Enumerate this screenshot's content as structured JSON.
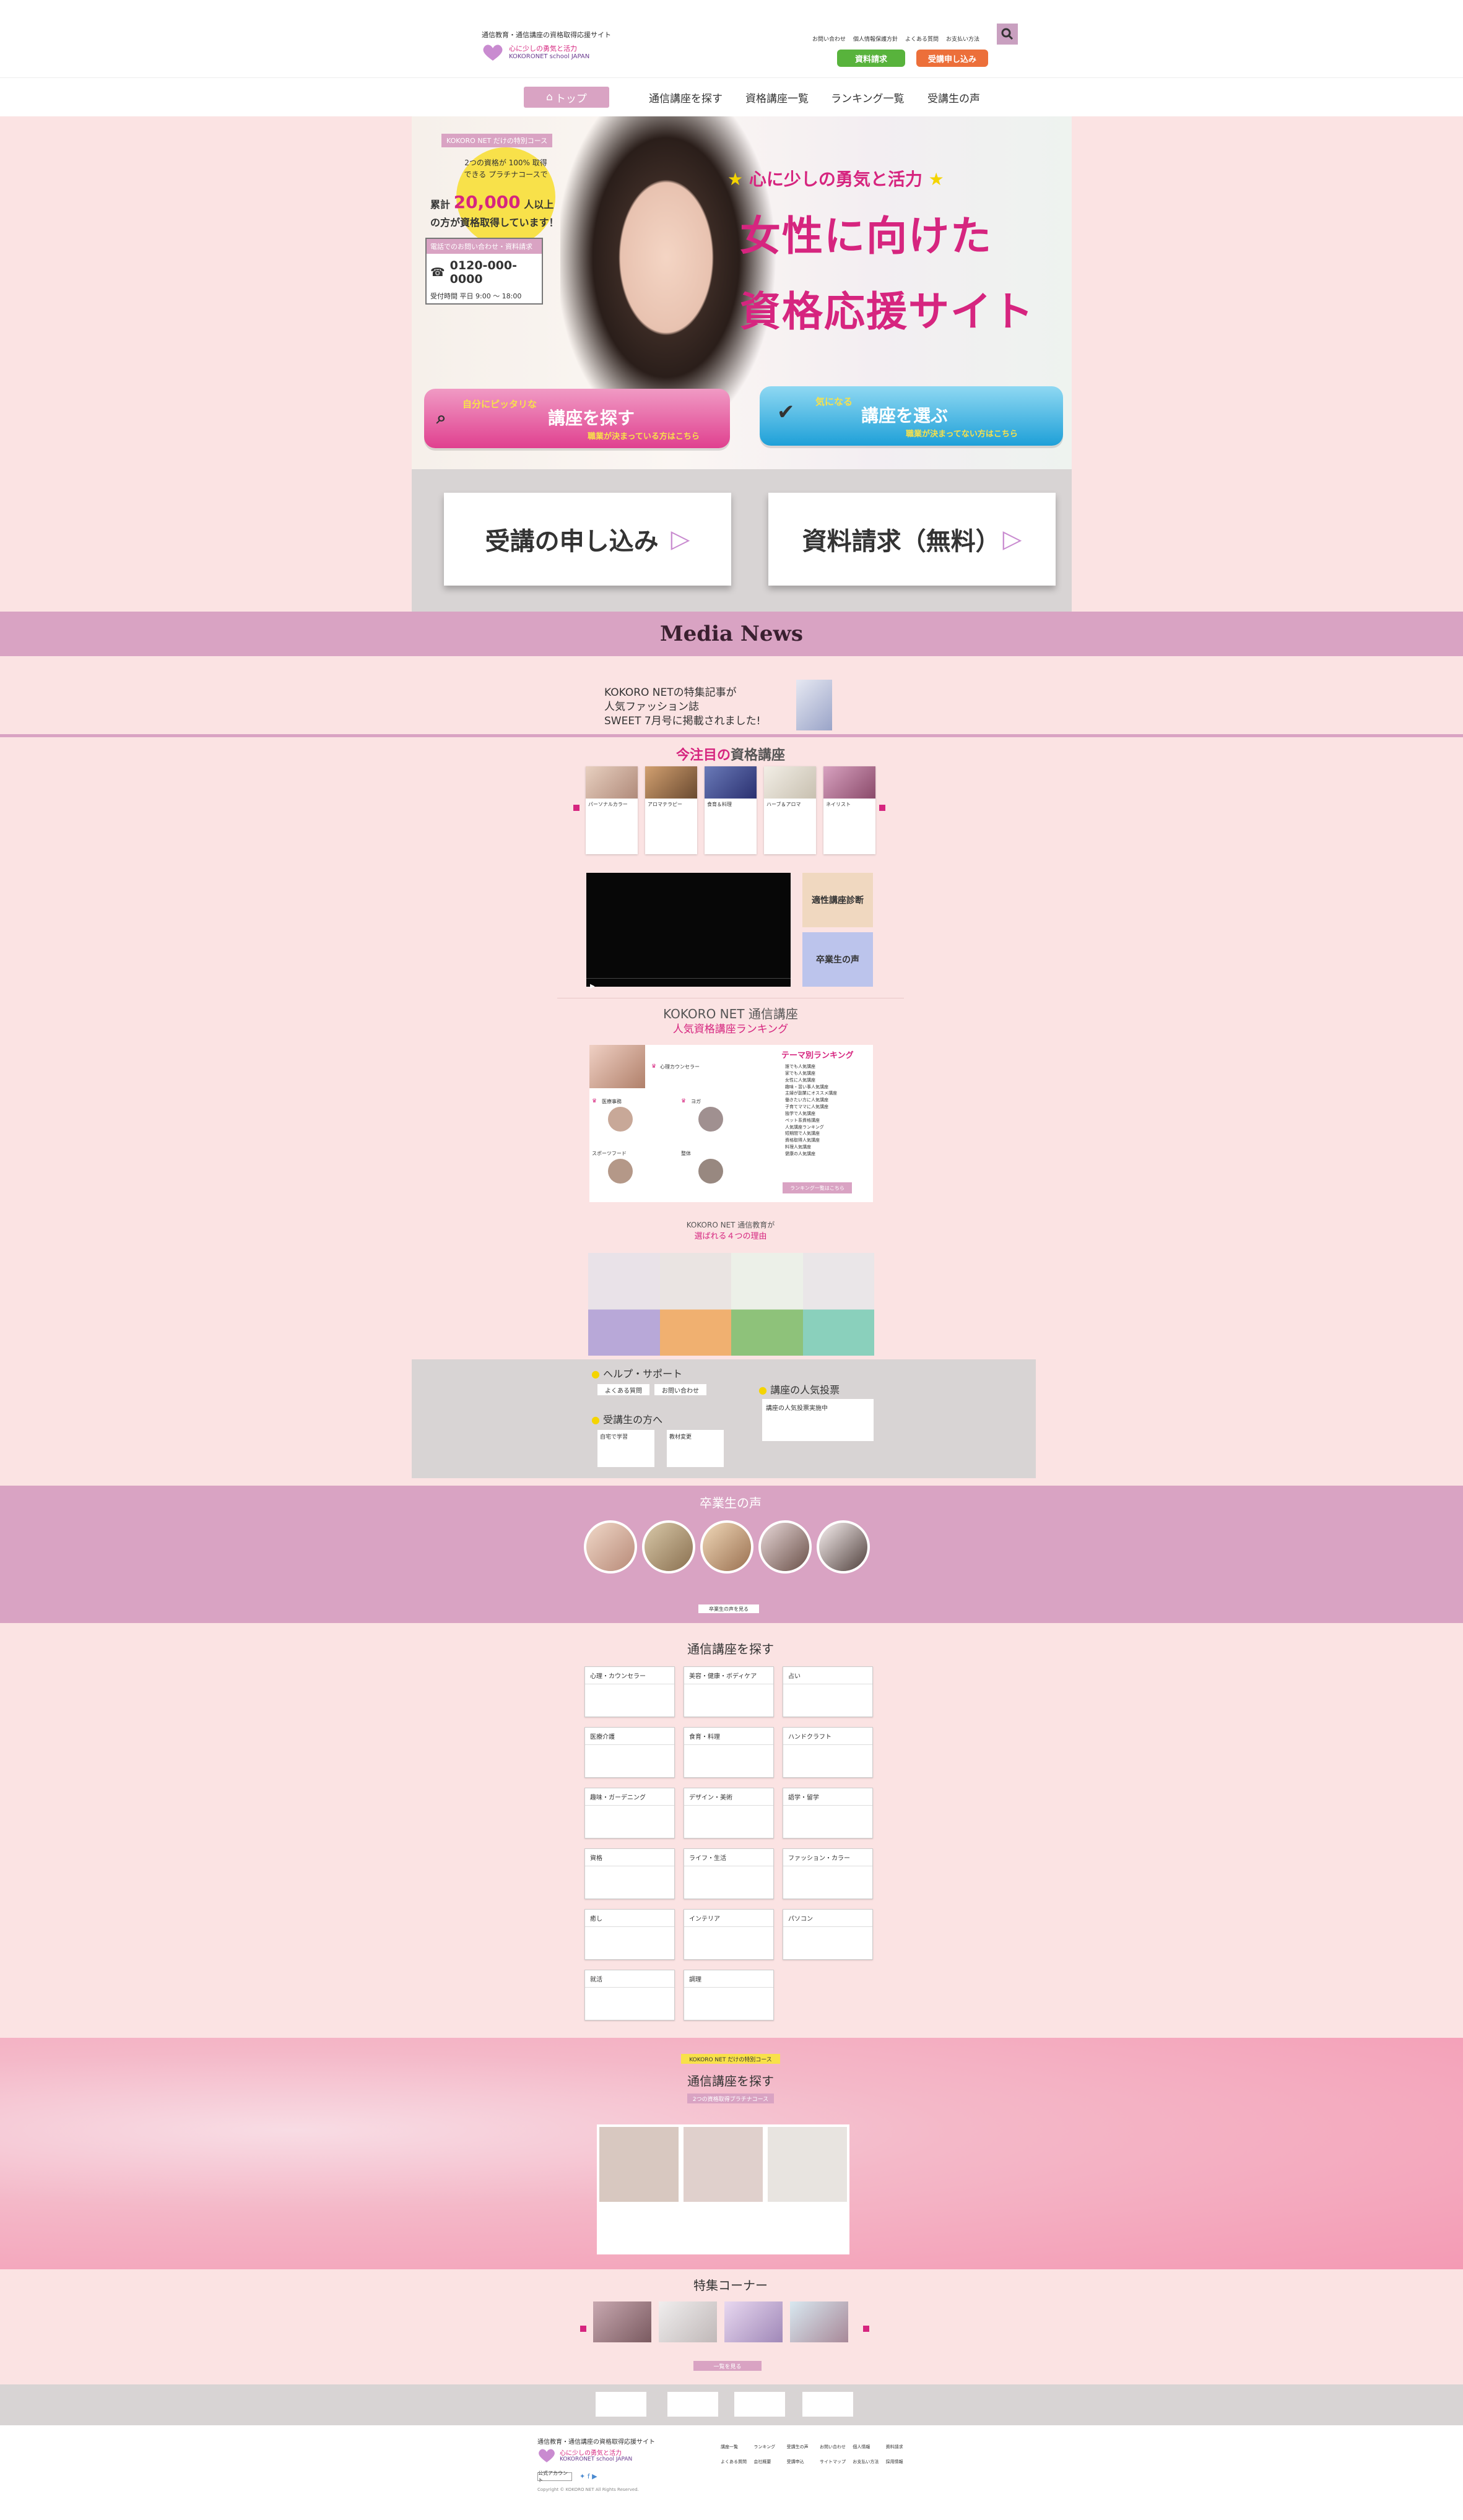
{
  "header": {
    "tagline": "通信教育・通信講座の資格取得応援サイト",
    "logo_line1": "心に少しの勇気と活力",
    "logo_line2": "KOKORONET school JAPAN",
    "util_links": [
      "お問い合わせ",
      "個人情報保護方針",
      "よくある質問",
      "お支払い方法"
    ],
    "btn_material": "資料請求",
    "btn_apply": "受講申し込み"
  },
  "nav": {
    "top": "トップ",
    "items": [
      "通信講座を探す",
      "資格講座一覧",
      "ランキング一覧",
      "受講生の声"
    ]
  },
  "hero": {
    "badge_top": "KOKORO NET だけの特別コース",
    "circle_text": "2つの資格が 100% 取得できる プラチナコースで",
    "count_prefix": "累計",
    "count": "20,000",
    "count_suffix": "人以上",
    "count_line2": "の方が資格取得しています！",
    "phone_label": "電話でのお問い合わせ・資料請求",
    "phone": "0120-000-0000",
    "hours": "受付時間 平日 9:00 〜 18:00",
    "subtitle": "心に少しの勇気と活力",
    "title1": "女性に向けた",
    "title2": "資格応援サイト",
    "cta_search_small": "自分にピッタリな",
    "cta_search": "講座を探す",
    "cta_search_sub": "職業が決まっている方はこちら",
    "cta_choose_small": "気になる",
    "cta_choose": "講座を選ぶ",
    "cta_choose_sub": "職業が決まってない方はこちら"
  },
  "apply": {
    "apply_btn": "受講の申し込み",
    "material_btn": "資料請求（無料）"
  },
  "media": {
    "title": "Media News",
    "line1": "KOKORO NETの特集記事が",
    "line2": "人気ファッション誌",
    "line3": "SWEET 7月号に掲載されました!"
  },
  "featured": {
    "title_pink": "今注目の",
    "title_rest": "資格講座",
    "items": [
      "パーソナルカラー",
      "アロマテラピー",
      "食育＆料理",
      "ハーブ＆アロマ",
      "ネイリスト"
    ]
  },
  "video_side": {
    "diagnosis": "適性講座診断",
    "voice": "卒業生の声"
  },
  "ranking": {
    "title1": "KOKORO NET 通信講座",
    "title2": "人気資格講座ランキング",
    "left_items": [
      "心理カウンセラー",
      "医療事務",
      "ヨガ",
      "スポーツフード",
      "整体"
    ],
    "theme_title": "テーマ別ランキング",
    "theme_items": [
      "誰でも人気講座",
      "家でも人気講座",
      "女性に人気講座",
      "趣味・習い事人気講座",
      "主婦が副業にオススメ講座",
      "働きたい方に人気講座",
      "子育てママに人気講座",
      "独学で人気講座",
      "ペット系資格講座",
      "人気講座ランキング",
      "短期間で人気講座",
      "資格取得人気講座",
      "料理人気講座",
      "健康の人気講座"
    ],
    "more": "ランキング一覧はこちら"
  },
  "reasons": {
    "line1": "KOKORO NET 通信教育が",
    "line2": "選ばれる４つの理由"
  },
  "help": {
    "title": "ヘルプ・サポート",
    "links": [
      "よくある質問",
      "お問い合わせ"
    ],
    "students_title": "受講生の方へ",
    "student_boxes": [
      "自宅で学習",
      "教材変更"
    ],
    "vote_title": "講座の人気投票",
    "vote_box": "講座の人気投票実施中"
  },
  "voices": {
    "title": "卒業生の声",
    "more": "卒業生の声を見る"
  },
  "search": {
    "title": "通信講座を探す",
    "categories": [
      "心理・カウンセラー",
      "美容・健康・ボディケア",
      "占い",
      "医療介護",
      "食育・料理",
      "ハンドクラフト",
      "趣味・ガーデニング",
      "デザイン・美術",
      "語学・留学",
      "資格",
      "ライフ・生活",
      "ファッション・カラー",
      "癒し",
      "インテリア",
      "パソコン",
      "就活",
      "調理"
    ]
  },
  "special": {
    "badge": "KOKORO NET だけの特別コース",
    "title": "通信講座を探す",
    "sub": "2つの資格取得プラチナコース"
  },
  "features": {
    "title": "特集コーナー",
    "more": "一覧を見る"
  },
  "footer": {
    "tagline": "通信教育・通信講座の資格取得応援サイト",
    "logo_line1": "心に少しの勇気と活力",
    "logo_line2": "KOKORONET school JAPAN",
    "follow": "公式アカウント",
    "copyright": "Copyright © KOKORO NET All Rights Reserved.",
    "links": [
      "講座一覧",
      "ランキング",
      "受講生の声",
      "お問い合わせ",
      "個人情報",
      "資料請求",
      "よくある質問",
      "会社概要",
      "受講申込",
      "サイトマップ",
      "お支払い方法",
      "採用情報"
    ]
  },
  "colors": {
    "pink": "#d6257f",
    "mauve": "#d9a3c3",
    "bg": "#fbe3e3"
  }
}
